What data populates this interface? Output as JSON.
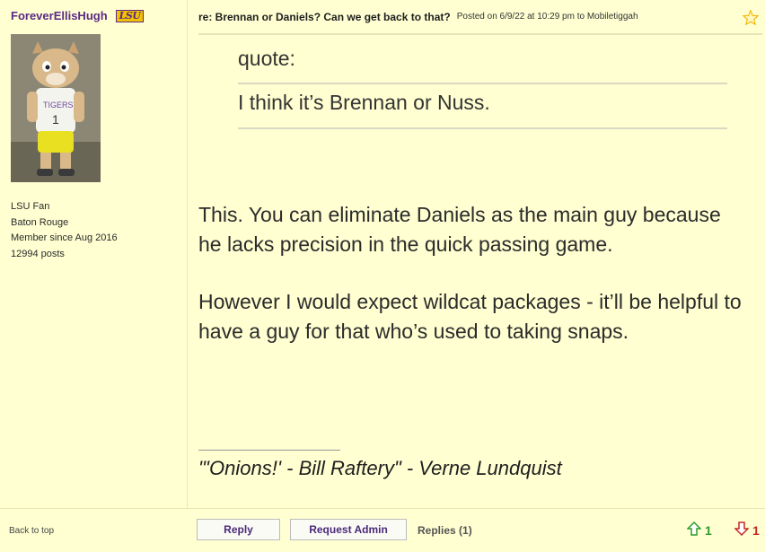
{
  "user": {
    "name": "ForeverEllisHugh",
    "team_logo": "LSU",
    "fan_of": "LSU Fan",
    "location": "Baton Rouge",
    "member_since": "Member since Aug 2016",
    "posts": "12994 posts"
  },
  "post": {
    "title": "re: Brennan or Daniels? Can we get back to that?",
    "meta": "Posted on 6/9/22 at 10:29 pm to Mobiletiggah",
    "quote_label": "quote:",
    "quote_text": "I think it’s Brennan or Nuss.",
    "paragraphs": [
      "This. You can eliminate Daniels as the main guy because he lacks precision in the quick passing game.",
      "However I would expect wildcat packages - it’ll be helpful to have a guy for that who’s used to taking snaps."
    ],
    "signature": "\"'Onions!' - Bill Raftery\" - Verne Lundquist"
  },
  "footer": {
    "back_to_top": "Back to top",
    "reply_label": "Reply",
    "request_admin_label": "Request Admin",
    "replies_label": "Replies (1)",
    "upvotes": "1",
    "downvotes": "1"
  },
  "colors": {
    "background": "#ffffd2",
    "username": "#5b2a86",
    "upvote": "#2e9c2e",
    "downvote": "#c62828",
    "star": "#f2b705"
  },
  "icons": [
    "star-icon",
    "upvote-arrow-icon",
    "downvote-arrow-icon"
  ]
}
